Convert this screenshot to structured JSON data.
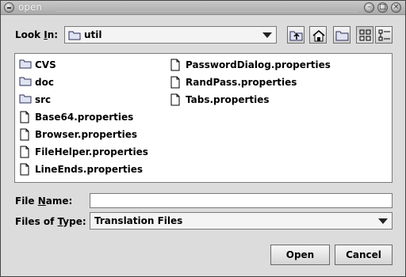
{
  "window": {
    "title": "open",
    "buttons": [
      "minimize-icon",
      "maximize-icon",
      "close-icon"
    ]
  },
  "look_in": {
    "label_pre": "Look ",
    "label_mnemonic": "I",
    "label_post": "n:",
    "value": "util"
  },
  "toolbar": {
    "icons": [
      "up-one-level-icon",
      "home-icon",
      "new-folder-icon",
      "list-view-icon",
      "details-view-icon"
    ],
    "active": "list-view-icon"
  },
  "files": {
    "items": [
      {
        "name": "CVS",
        "type": "folder"
      },
      {
        "name": "doc",
        "type": "folder"
      },
      {
        "name": "src",
        "type": "folder"
      },
      {
        "name": "Base64.properties",
        "type": "file"
      },
      {
        "name": "Browser.properties",
        "type": "file"
      },
      {
        "name": "FileHelper.properties",
        "type": "file"
      },
      {
        "name": "LineEnds.properties",
        "type": "file"
      },
      {
        "name": "PasswordDialog.properties",
        "type": "file"
      },
      {
        "name": "RandPass.properties",
        "type": "file"
      },
      {
        "name": "Tabs.properties",
        "type": "file"
      }
    ]
  },
  "file_name": {
    "label_pre": "File ",
    "label_mnemonic": "N",
    "label_post": "ame:",
    "value": ""
  },
  "file_type": {
    "label_pre": "Files of ",
    "label_mnemonic": "T",
    "label_post": "ype:",
    "value": "Translation Files"
  },
  "actions": {
    "open": "Open",
    "cancel": "Cancel"
  }
}
